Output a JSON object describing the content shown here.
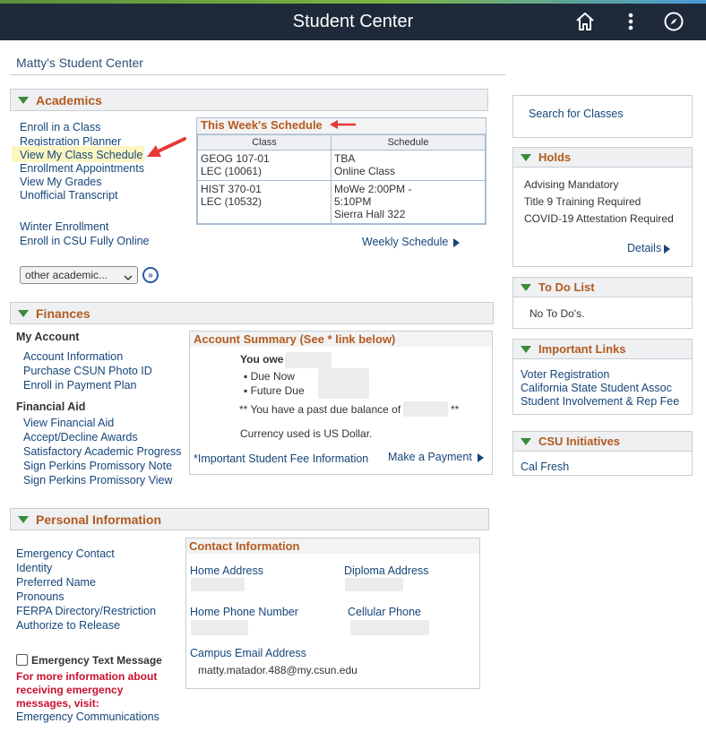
{
  "header": {
    "title": "Student Center",
    "icons": [
      "home-icon",
      "more-vert-icon",
      "compass-icon"
    ]
  },
  "page_title": "Matty's Student Center",
  "academics": {
    "title": "Academics",
    "links_a": [
      "Enroll in a Class",
      "Registration Planner",
      "View My Class Schedule",
      "Enrollment Appointments",
      "View My Grades",
      "Unofficial Transcript"
    ],
    "links_b": [
      "Winter Enrollment",
      "Enroll in CSU Fully Online"
    ],
    "select_value": "other academic...",
    "go_label": "»",
    "schedule": {
      "title": "This Week's Schedule",
      "col_class": "Class",
      "col_schedule": "Schedule",
      "rows": [
        {
          "class_1": "GEOG 107-01",
          "class_2": "LEC (10061)",
          "sched_1": "TBA",
          "sched_2": "Online Class",
          "sched_3": ""
        },
        {
          "class_1": "HIST 370-01",
          "class_2": "LEC (10532)",
          "sched_1": "MoWe 2:00PM -",
          "sched_2": "5:10PM",
          "sched_3": "Sierra Hall 322"
        }
      ],
      "weekly_link": "Weekly Schedule"
    }
  },
  "finances": {
    "title": "Finances",
    "my_account_label": "My Account",
    "my_account_links": [
      "Account Information",
      "Purchase CSUN Photo ID",
      "Enroll in Payment Plan"
    ],
    "financial_aid_label": "Financial Aid",
    "financial_aid_links": [
      "View Financial Aid",
      "Accept/Decline Awards",
      "Satisfactory Academic Progress",
      "Sign Perkins Promissory Note",
      "Sign Perkins Promissory View"
    ],
    "summary": {
      "title": "Account Summary (See * link below)",
      "you_owe": "You owe",
      "due_now": "Due Now",
      "future_due": "Future Due",
      "past_due_text": "** You have a past due balance of",
      "past_due_tail": "**",
      "currency": "Currency used is US Dollar.",
      "fee_link": "*Important Student Fee Information",
      "payment_link": "Make a Payment"
    }
  },
  "personal": {
    "title": "Personal Information",
    "links": [
      "Emergency Contact",
      "Identity",
      "Preferred Name",
      "Pronouns",
      "FERPA Directory/Restriction",
      "Authorize to Release"
    ],
    "checkbox_label": "Emergency Text Message",
    "info_red": [
      "For more information about",
      "receiving emergency",
      "messages, visit:"
    ],
    "emergency_link": "Emergency Communications",
    "contact": {
      "title": "Contact Information",
      "home_address": "Home Address",
      "diploma_address": "Diploma Address",
      "home_phone": "Home Phone Number",
      "cell_phone": "Cellular Phone",
      "email_label": "Campus Email Address",
      "email_value": "matty.matador.488@my.csun.edu"
    }
  },
  "right": {
    "search_link": "Search for Classes",
    "holds": {
      "title": "Holds",
      "items": [
        "Advising Mandatory",
        "Title 9 Training Required",
        "COVID-19 Attestation Required"
      ],
      "details": "Details"
    },
    "todo": {
      "title": "To Do List",
      "text": "No To Do's."
    },
    "important_links": {
      "title": "Important Links",
      "items": [
        "Voter Registration",
        "California State Student Assoc",
        "Student Involvement & Rep Fee"
      ]
    },
    "csu_initiatives": {
      "title": "CSU Initiatives",
      "items": [
        "Cal Fresh"
      ]
    }
  },
  "colors": {
    "header_bg": "#1e2a3a",
    "section_title": "#b35a1f",
    "link": "#16467a",
    "annotation_arrow": "#e53935"
  }
}
